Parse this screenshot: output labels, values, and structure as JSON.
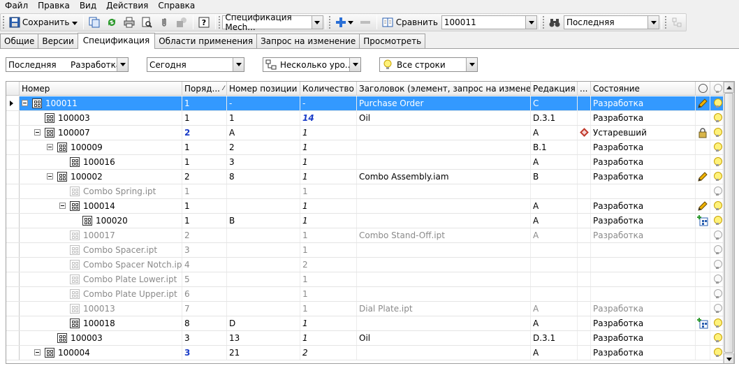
{
  "menu": [
    "Файл",
    "Правка",
    "Вид",
    "Действия",
    "Справка"
  ],
  "toolbar": {
    "save_label": "Сохранить",
    "spec_combo": "Спецификация Mech...",
    "compare_label": "Сравнить",
    "compare_value": "100011",
    "search_value": "Последняя"
  },
  "tabs": [
    "Общие",
    "Версии",
    "Спецификация",
    "Области применения",
    "Запрос на изменение",
    "Просмотреть"
  ],
  "active_tab": 2,
  "filters": {
    "version": "Последняя",
    "state": "Разработка",
    "date": "Сегодня",
    "levels": "Несколько уро...",
    "rows": "Все строки"
  },
  "columns": [
    "Номер",
    "Поряд...",
    "Номер позиции",
    "Количество",
    "Заголовок (элемент, запрос на изменение)",
    "Редакция",
    "...",
    "Состояние"
  ],
  "rows": [
    {
      "level": 0,
      "expand": true,
      "number": "100011",
      "order": "1",
      "pos": "-",
      "qty": "-",
      "title": "Purchase Order",
      "rev": "C",
      "state": "Разработка",
      "selected": true,
      "dim": false,
      "icon": "pencil",
      "bulb": "on"
    },
    {
      "level": 1,
      "expand": false,
      "number": "100003",
      "order": "1",
      "pos": "1",
      "qty": "14",
      "qtyStyle": "blue-italic",
      "title": "Oil",
      "rev": "D.3.1",
      "state": "Разработка",
      "dim": false,
      "bulb": "on"
    },
    {
      "level": 1,
      "expand": true,
      "number": "100007",
      "order": "2",
      "orderStyle": "blue",
      "pos": "A",
      "qty": "1",
      "title": "",
      "rev": "A",
      "state": "Устаревший",
      "obsolete": true,
      "dim": false,
      "icon": "lock",
      "bulb": "on"
    },
    {
      "level": 2,
      "expand": true,
      "number": "100009",
      "order": "1",
      "pos": "2",
      "qty": "1",
      "title": "",
      "rev": "B.1",
      "state": "Разработка",
      "dim": false,
      "bulb": "on"
    },
    {
      "level": 3,
      "expand": false,
      "number": "100016",
      "order": "1",
      "pos": "3",
      "qty": "1",
      "title": "",
      "rev": "A",
      "state": "Разработка",
      "dim": false,
      "bulb": "on"
    },
    {
      "level": 2,
      "expand": true,
      "number": "100002",
      "order": "2",
      "pos": "8",
      "qty": "1",
      "title": "Combo Assembly.iam",
      "rev": "B",
      "state": "Разработка",
      "dim": false,
      "icon": "pencil",
      "bulb": "on"
    },
    {
      "level": 3,
      "expand": false,
      "number": "Combo Spring.ipt",
      "order": "1",
      "pos": "",
      "qty": "1",
      "title": "",
      "rev": "",
      "state": "",
      "dim": true,
      "bulb": "off"
    },
    {
      "level": 3,
      "expand": true,
      "number": "100014",
      "order": "1",
      "pos": "",
      "qty": "1",
      "title": "",
      "rev": "A",
      "state": "Разработка",
      "dim": false,
      "icon": "pencil",
      "bulb": "on"
    },
    {
      "level": 4,
      "expand": false,
      "number": "100020",
      "order": "1",
      "pos": "B",
      "qty": "1",
      "title": "",
      "rev": "A",
      "state": "Разработка",
      "dim": false,
      "icon": "add",
      "bulb": "on"
    },
    {
      "level": 3,
      "expand": false,
      "number": "100017",
      "order": "2",
      "pos": "",
      "qty": "1",
      "title": "Combo Stand-Off.ipt",
      "rev": "A",
      "state": "Разработка",
      "dim": true,
      "bulb": "off"
    },
    {
      "level": 3,
      "expand": false,
      "number": "Combo Spacer.ipt",
      "order": "3",
      "pos": "",
      "qty": "1",
      "title": "",
      "rev": "",
      "state": "",
      "dim": true,
      "bulb": "off"
    },
    {
      "level": 3,
      "expand": false,
      "number": "Combo Spacer Notch.ipt",
      "order": "4",
      "pos": "",
      "qty": "2",
      "title": "",
      "rev": "",
      "state": "",
      "dim": true,
      "bulb": "off"
    },
    {
      "level": 3,
      "expand": false,
      "number": "Combo Plate Lower.ipt",
      "order": "5",
      "pos": "",
      "qty": "1",
      "title": "",
      "rev": "",
      "state": "",
      "dim": true,
      "bulb": "off"
    },
    {
      "level": 3,
      "expand": false,
      "number": "Combo Plate Upper.ipt",
      "order": "6",
      "pos": "",
      "qty": "1",
      "title": "",
      "rev": "",
      "state": "",
      "dim": true,
      "bulb": "off"
    },
    {
      "level": 3,
      "expand": false,
      "number": "100013",
      "order": "7",
      "pos": "",
      "qty": "1",
      "title": "Dial Plate.ipt",
      "rev": "A",
      "state": "Разработка",
      "dim": true,
      "bulb": "off"
    },
    {
      "level": 3,
      "expand": false,
      "number": "100018",
      "order": "8",
      "pos": "D",
      "qty": "1",
      "title": "",
      "rev": "A",
      "state": "Разработка",
      "dim": false,
      "icon": "add",
      "bulb": "on"
    },
    {
      "level": 2,
      "expand": false,
      "number": "100003",
      "order": "3",
      "pos": "13",
      "qty": "1",
      "title": "Oil",
      "rev": "D.3.1",
      "state": "Разработка",
      "dim": false,
      "bulb": "on"
    },
    {
      "level": 1,
      "expand": true,
      "number": "100004",
      "order": "3",
      "orderStyle": "blue",
      "pos": "21",
      "qty": "2",
      "title": "",
      "rev": "A",
      "state": "Разработка",
      "dim": false,
      "bulb": "on"
    }
  ]
}
